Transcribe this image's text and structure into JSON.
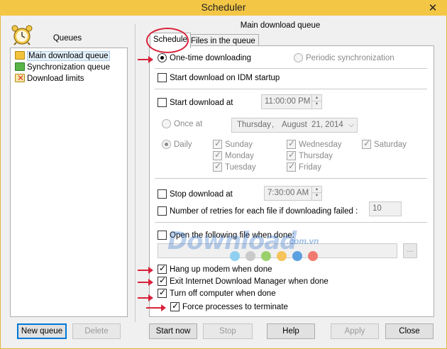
{
  "window": {
    "title": "Scheduler",
    "close_glyph": "✕"
  },
  "queues": {
    "title": "Queues",
    "logo_icon": "alarm-clock-icon",
    "items": [
      {
        "label": "Main download queue",
        "icon": "main-queue-icon",
        "color": "#f2c23a"
      },
      {
        "label": "Synchronization queue",
        "icon": "sync-queue-icon",
        "color": "#59b548"
      },
      {
        "label": "Download limits",
        "icon": "limits-icon",
        "color": "#d9372b"
      }
    ],
    "new_queue": "New queue",
    "delete": "Delete"
  },
  "main": {
    "title": "Main download queue",
    "tabs": [
      {
        "label": "Schedule"
      },
      {
        "label": "Files in the queue"
      }
    ]
  },
  "schedule": {
    "one_time": "One-time downloading",
    "periodic": "Periodic synchronization",
    "start_on_startup": "Start download on IDM startup",
    "start_at": "Start download at",
    "start_time": "11:00:00 PM",
    "once_at": "Once at",
    "date": {
      "weekday": "Thursday",
      "sep": ",",
      "month": "August",
      "day_year": "21, 2014"
    },
    "daily": "Daily",
    "days": {
      "sunday": "Sunday",
      "monday": "Monday",
      "tuesday": "Tuesday",
      "wednesday": "Wednesday",
      "thursday": "Thursday",
      "friday": "Friday",
      "saturday": "Saturday"
    },
    "stop_at": "Stop download at",
    "stop_time": "7:30:00 AM",
    "retries_label": "Number of retries for each file if downloading failed :",
    "retries_value": "10",
    "open_file": "Open the following file when done:",
    "browse": "...",
    "hang_up": "Hang up modem when done",
    "exit_idm": "Exit Internet Download Manager when done",
    "turn_off": "Turn off computer when done",
    "force_terminate": "Force processes to terminate"
  },
  "buttons": {
    "start_now": "Start now",
    "stop": "Stop",
    "help": "Help",
    "apply": "Apply",
    "close": "Close"
  },
  "watermark": {
    "text": "Download",
    "domain": ".com.vn"
  },
  "colors": {
    "title_bar": "#f3c646",
    "annotation": "#d8223a",
    "selection": "#e5f1fb"
  }
}
